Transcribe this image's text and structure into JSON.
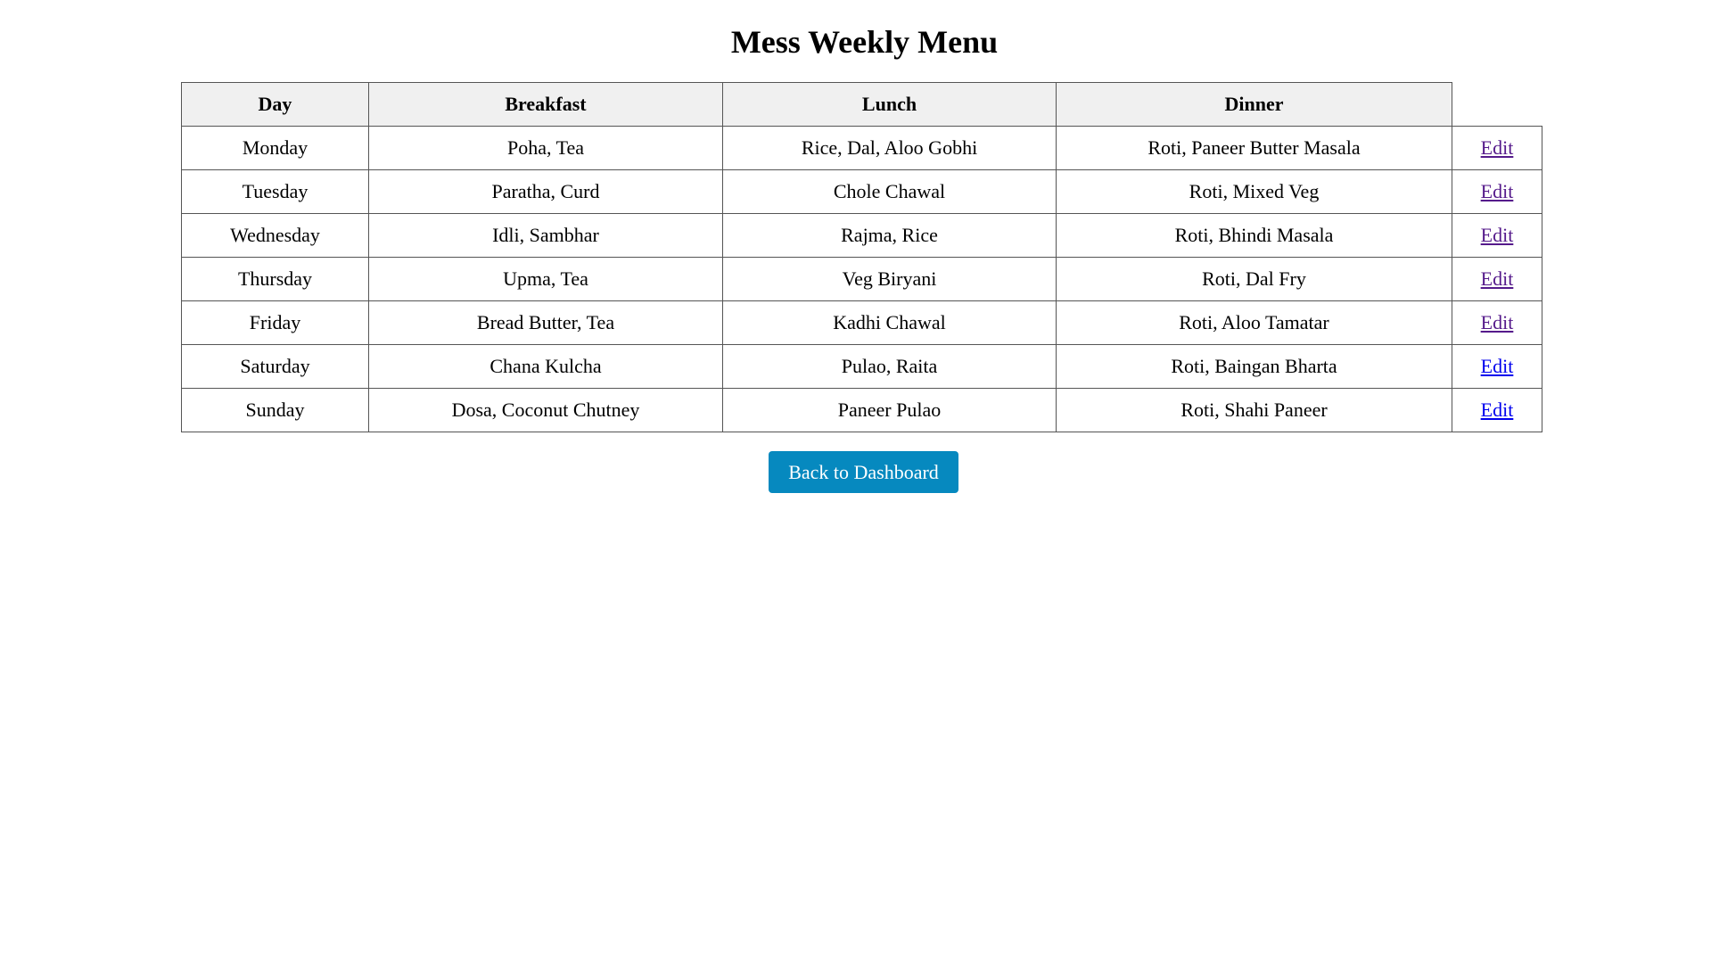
{
  "page": {
    "title": "Mess Weekly Menu"
  },
  "table": {
    "headers": {
      "day": "Day",
      "breakfast": "Breakfast",
      "lunch": "Lunch",
      "dinner": "Dinner"
    },
    "rows": [
      {
        "day": "Monday",
        "breakfast": "Poha, Tea",
        "lunch": "Rice, Dal, Aloo Gobhi",
        "dinner": "Roti, Paneer Butter Masala",
        "action": "Edit"
      },
      {
        "day": "Tuesday",
        "breakfast": "Paratha, Curd",
        "lunch": "Chole Chawal",
        "dinner": "Roti, Mixed Veg",
        "action": "Edit"
      },
      {
        "day": "Wednesday",
        "breakfast": "Idli, Sambhar",
        "lunch": "Rajma, Rice",
        "dinner": "Roti, Bhindi Masala",
        "action": "Edit"
      },
      {
        "day": "Thursday",
        "breakfast": "Upma, Tea",
        "lunch": "Veg Biryani",
        "dinner": "Roti, Dal Fry",
        "action": "Edit"
      },
      {
        "day": "Friday",
        "breakfast": "Bread Butter, Tea",
        "lunch": "Kadhi Chawal",
        "dinner": "Roti, Aloo Tamatar",
        "action": "Edit"
      },
      {
        "day": "Saturday",
        "breakfast": "Chana Kulcha",
        "lunch": "Pulao, Raita",
        "dinner": "Roti, Baingan Bharta",
        "action": "Edit"
      },
      {
        "day": "Sunday",
        "breakfast": "Dosa, Coconut Chutney",
        "lunch": "Paneer Pulao",
        "dinner": "Roti, Shahi Paneer",
        "action": "Edit"
      }
    ]
  },
  "colors": {
    "button_bg": "#0689bf",
    "visited_link": "#551a8b",
    "unvisited_link": "#0000ee",
    "header_bg": "#f0f0f0"
  },
  "back_button": {
    "label": "Back to Dashboard"
  }
}
